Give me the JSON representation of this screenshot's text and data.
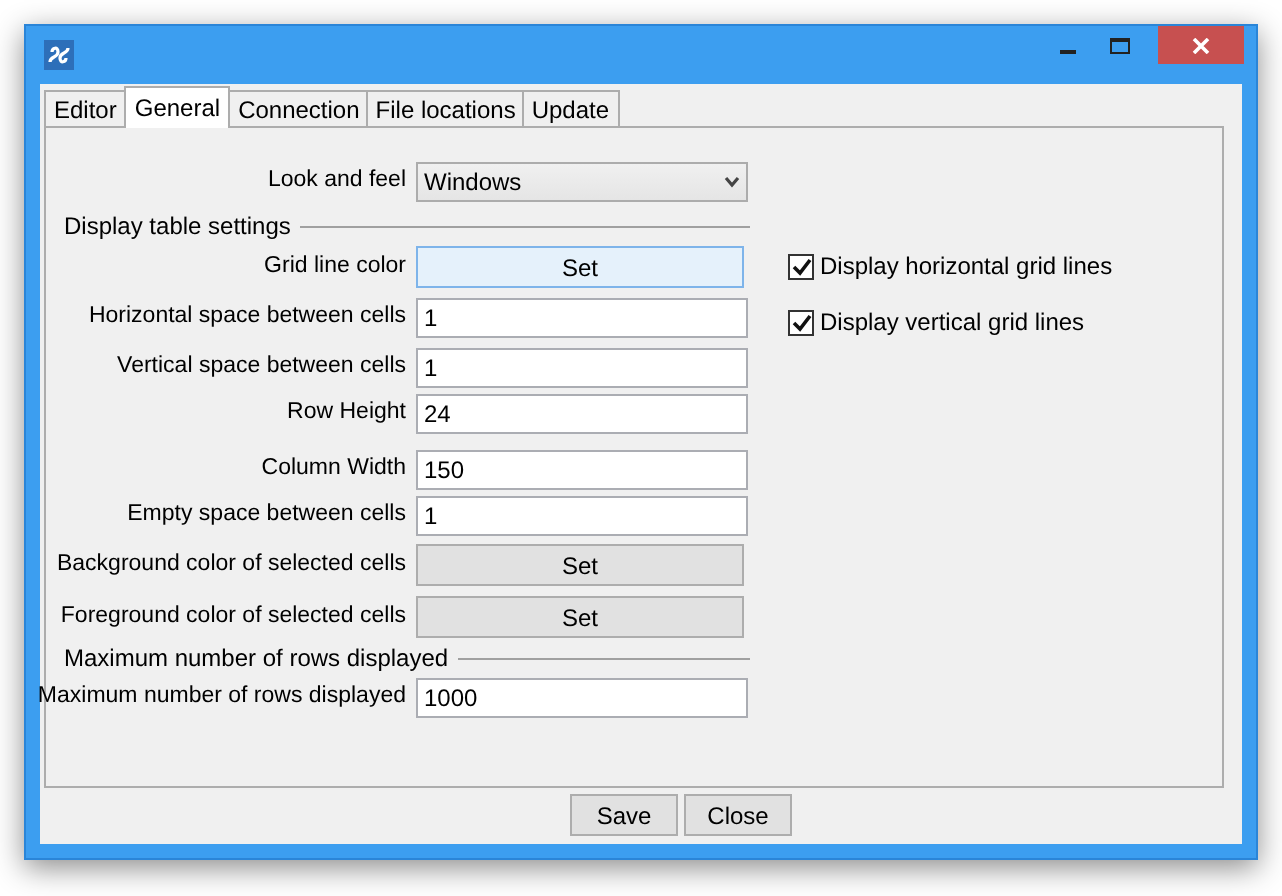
{
  "tabs": [
    {
      "label": "Editor",
      "selected": false
    },
    {
      "label": "General",
      "selected": true
    },
    {
      "label": "Connection",
      "selected": false
    },
    {
      "label": "File locations",
      "selected": false
    },
    {
      "label": "Update",
      "selected": false
    }
  ],
  "rows": [
    {
      "kind": "select",
      "label": "Look and feel",
      "value": "Windows"
    },
    {
      "kind": "section",
      "label": "Display table settings"
    },
    {
      "kind": "button",
      "label": "Grid line color",
      "value": "Set",
      "focused": true
    },
    {
      "kind": "text",
      "label": "Horizontal space between cells",
      "value": "1"
    },
    {
      "kind": "text",
      "label": "Vertical space between cells",
      "value": "1"
    },
    {
      "kind": "text",
      "label": "Row Height",
      "value": "24"
    },
    {
      "kind": "text",
      "label": "Column Width",
      "value": "150"
    },
    {
      "kind": "text",
      "label": "Empty space between cells",
      "value": "1"
    },
    {
      "kind": "button",
      "label": "Background color of selected cells",
      "value": "Set",
      "focused": false
    },
    {
      "kind": "button",
      "label": "Foreground color of selected cells",
      "value": "Set",
      "focused": false
    },
    {
      "kind": "section",
      "label": "Maximum number of rows displayed"
    },
    {
      "kind": "text",
      "label": "Maximum number of rows displayed",
      "value": "1000"
    }
  ],
  "checkboxes": [
    {
      "label": "Display horizontal grid lines",
      "checked": true
    },
    {
      "label": "Display vertical grid lines",
      "checked": true
    }
  ],
  "buttons": [
    "Save",
    "Close"
  ]
}
